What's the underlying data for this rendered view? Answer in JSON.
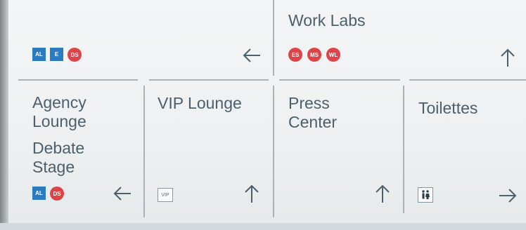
{
  "sections": {
    "work_labs": {
      "title": "Work Labs",
      "badges": [
        "ES",
        "MS",
        "WL"
      ],
      "arrow": "up"
    },
    "top_left": {
      "badges": [
        "AL",
        "E",
        "DS"
      ],
      "arrow": "left"
    },
    "agency": {
      "line1": "Agency",
      "line2": "Lounge",
      "line3": "Debate",
      "line4": "Stage",
      "badges": [
        "AL",
        "DS"
      ],
      "arrow": "left"
    },
    "vip_lounge": {
      "title": "VIP Lounge",
      "icon_label": "VIP",
      "arrow": "up"
    },
    "press_center": {
      "line1": "Press",
      "line2": "Center",
      "arrow": "up"
    },
    "toilettes": {
      "title": "Toilettes",
      "icon": "restroom-icon",
      "arrow": "right"
    }
  },
  "colors": {
    "text": "#4d5f6b",
    "badge_blue": "#2a7bc1",
    "badge_red": "#de4447",
    "rule": "#a9b2b8"
  }
}
